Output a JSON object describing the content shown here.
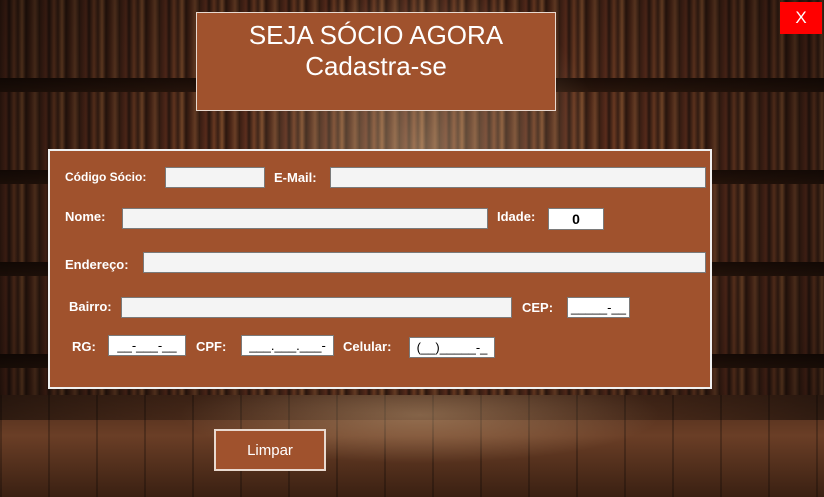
{
  "window": {
    "close_label": "X"
  },
  "header": {
    "title": "SEJA SÓCIO AGORA",
    "subtitle": "Cadastra-se"
  },
  "form": {
    "codigo_label": "Código Sócio:",
    "codigo_value": "",
    "email_label": "E-Mail:",
    "email_value": "",
    "nome_label": "Nome:",
    "nome_value": "",
    "idade_label": "Idade:",
    "idade_value": "0",
    "endereco_label": "Endereço:",
    "endereco_value": "",
    "bairro_label": "Bairro:",
    "bairro_value": "",
    "cep_label": "CEP:",
    "cep_mask": "_____-__",
    "rg_label": "RG:",
    "rg_mask": "__-___-__",
    "cpf_label": "CPF:",
    "cpf_mask": "___.___.___-",
    "celular_label": "Celular:",
    "celular_mask": "(__)_____-_"
  },
  "actions": {
    "clear_label": "Limpar"
  },
  "colors": {
    "panel": "#a0522d",
    "close": "#ff0000"
  }
}
